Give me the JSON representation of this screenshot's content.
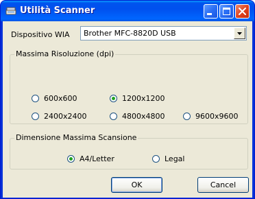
{
  "window": {
    "title": "Utilità Scanner"
  },
  "device": {
    "label": "Dispositivo WIA",
    "selected": "Brother MFC-8820D USB"
  },
  "resolution_group": {
    "title": "Massima Risoluzione (dpi)",
    "options": [
      "600x600",
      "1200x1200",
      "2400x2400",
      "4800x4800",
      "9600x9600"
    ],
    "selected": "1200x1200"
  },
  "scan_size_group": {
    "title": "Dimensione Massima Scansione",
    "options": [
      "A4/Letter",
      "Legal"
    ],
    "selected": "A4/Letter"
  },
  "buttons": {
    "ok": "OK",
    "cancel": "Cancel"
  },
  "colors": {
    "titlebar": "#0058ee",
    "dialog_bg": "#ece9d8",
    "close_button": "#e0401b",
    "radio_check": "#21a121"
  },
  "icons": {
    "title": "scanner-icon",
    "minimize": "minimize-icon",
    "maximize": "maximize-icon",
    "close": "close-icon",
    "dropdown": "chevron-down-icon"
  }
}
